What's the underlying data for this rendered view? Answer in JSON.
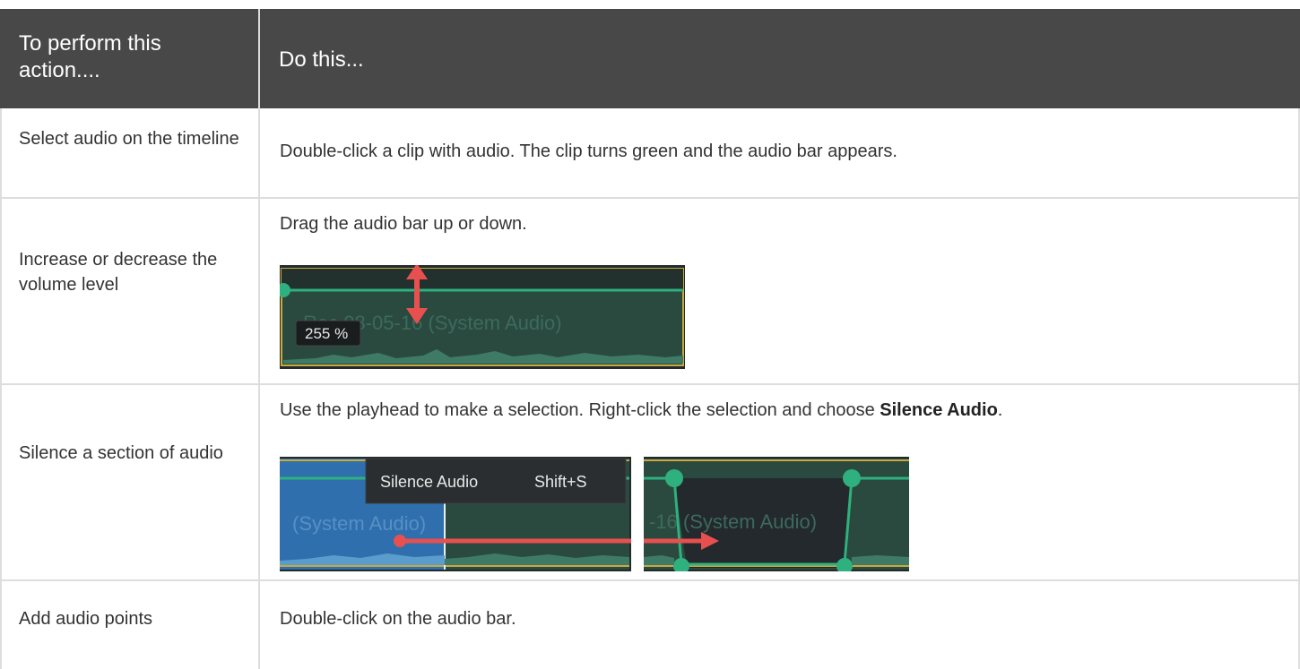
{
  "table": {
    "header": {
      "col1": "To perform this action....",
      "col2": "Do this..."
    },
    "rows": [
      {
        "action": "Select audio on the timeline",
        "instruction": "Double-click a clip with audio. The clip turns green and the audio bar appears."
      },
      {
        "action": "Increase or decrease the volume level",
        "instruction": "Drag the audio bar up or down.",
        "image": {
          "clip_label": "Rec 08-05-16 (System Audio)",
          "volume_badge": "255 %"
        }
      },
      {
        "action": "Silence a section of audio",
        "instruction_pre": "Use the playhead to make a selection. Right-click the selection and choose ",
        "instruction_bold": "Silence Audio",
        "instruction_post": ".",
        "image_left": {
          "menu_item": "Silence Audio",
          "menu_shortcut": "Shift+S",
          "clip_label": "(System Audio)"
        },
        "image_right": {
          "clip_label": "-16 (System Audio)"
        }
      },
      {
        "action": "Add audio points",
        "instruction": "Double-click on the audio bar."
      }
    ]
  },
  "colors": {
    "header_bg": "#484848",
    "clip_green": "#2a4a40",
    "audio_line": "#2fb07f",
    "selection_blue": "#2f6fae",
    "arrow_red": "#e8504f"
  }
}
